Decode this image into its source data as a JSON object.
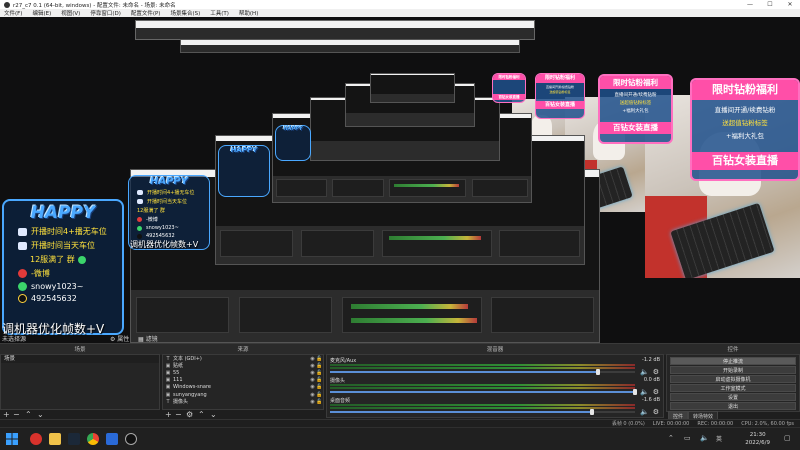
{
  "window": {
    "title": "r27_c7 0.1 (64-bit, windows) - 配置文件: 未命名 - 场景: 未命名",
    "controls": [
      "—",
      "☐",
      "✕"
    ]
  },
  "menu": [
    "文件(F)",
    "编辑(E)",
    "视图(V)",
    "停靠窗口(D)",
    "配置文件(P)",
    "场景集合(S)",
    "工具(T)",
    "帮助(H)"
  ],
  "overlay": {
    "promo": {
      "header": "限时钻粉福利",
      "lines": [
        "直播间开通/续费钻粉",
        "送超值钻粉标签",
        "+福利大礼包"
      ],
      "footer": "百钻女装直播"
    },
    "info_panel": {
      "logo": "HAPPY",
      "rows": [
        {
          "icon": "tv-icon",
          "text": "开播时间4+播无车位"
        },
        {
          "icon": "tv-icon",
          "text": "开播时间当天车位"
        },
        {
          "icon": "pin-icon",
          "text": "12服满了 群"
        },
        {
          "icon": "weibo-icon",
          "text": "-微博"
        },
        {
          "icon": "wechat-icon",
          "text": "snowy1023~"
        },
        {
          "icon": "qq-icon",
          "text": "492545632"
        }
      ],
      "caption": "调机器优化帧数+V"
    },
    "nested_caption": "调机器优化帧数+V"
  },
  "docks": {
    "scenes_title": "场景",
    "sources_title": "来源",
    "mixer_title": "混音器",
    "transitions_title": "转场",
    "controls_title": "控件",
    "left_label": "未选择源",
    "props_button": "属性",
    "filters_button": "滤镜"
  },
  "scenes": {
    "items": [
      "场景"
    ]
  },
  "sources": {
    "items": [
      {
        "icon": "T",
        "name": "文本 (GDI+)"
      },
      {
        "icon": "▣",
        "name": "贴纸"
      },
      {
        "icon": "▣",
        "name": "55"
      },
      {
        "icon": "▣",
        "name": "111"
      },
      {
        "icon": "▣",
        "name": "Windows-snare"
      },
      {
        "icon": "▣",
        "name": "sunyangyang"
      },
      {
        "icon": "T",
        "name": "摄像头"
      }
    ]
  },
  "mixer": {
    "channels": [
      {
        "name": "麦克风/Aux",
        "db": "-1.2 dB",
        "level": 0.88
      },
      {
        "name": "摄像头",
        "db": "0.0 dB",
        "level": 1.0
      },
      {
        "name": "桌面音频",
        "db": "-1.6 dB",
        "level": 0.86
      }
    ]
  },
  "controls": {
    "buttons": [
      "停止推流",
      "开始录制",
      "启动虚拟摄像机",
      "工作室模式",
      "设置",
      "退出"
    ],
    "tabs": [
      "控件",
      "转场特效"
    ]
  },
  "status": {
    "dropped": "丢帧 0 (0.0%)",
    "live": "LIVE: 00:00:00",
    "rec": "REC: 00:00:00",
    "cpu": "CPU: 2.0%, 60.00 fps"
  },
  "taskbar": {
    "time": "21:30",
    "date": "2022/6/9",
    "tray_icons": [
      "up-arrow-icon",
      "network-icon",
      "volume-icon",
      "ime-icon"
    ],
    "ime": "英"
  },
  "colors": {
    "obs_bg": "#1e1e1e",
    "promo_pink": "#ff4fa8",
    "info_blue": "#4aa8ff",
    "meter_green": "#2f8f35"
  }
}
